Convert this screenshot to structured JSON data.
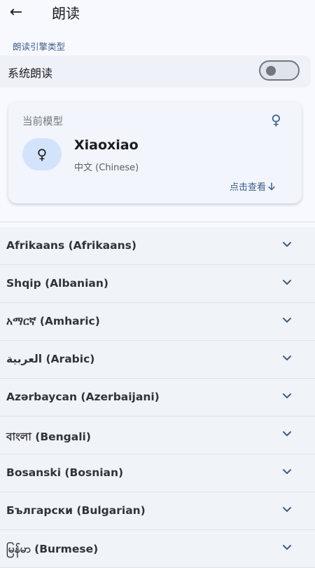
{
  "header": {
    "back_icon": "arrow-left-icon",
    "title": "朗读"
  },
  "engine": {
    "section_label": "朗读引擎类型",
    "row_label": "系统朗读",
    "toggle_on": false
  },
  "model_card": {
    "label": "当前模型",
    "gender_icon": "female-icon",
    "avatar_icon": "female-icon",
    "model_name": "Xiaoxiao",
    "model_language": "中文 (Chinese)",
    "view_link": "点击查看",
    "view_link_icon": "arrow-down-icon"
  },
  "languages": [
    "Afrikaans (Afrikaans)",
    "Shqip (Albanian)",
    "አማርኛ (Amharic)",
    "العربية (Arabic)",
    "Azərbaycan (Azerbaijani)",
    "বাংলা (Bengali)",
    "Bosanski (Bosnian)",
    "Български (Bulgarian)",
    "မြန်မာ (Burmese)"
  ],
  "colors": {
    "accent": "#3f5f8a",
    "card_bg": "#f2f5fb",
    "list_bg": "#f0f3f7",
    "avatar_bg": "#d3e3fc"
  }
}
